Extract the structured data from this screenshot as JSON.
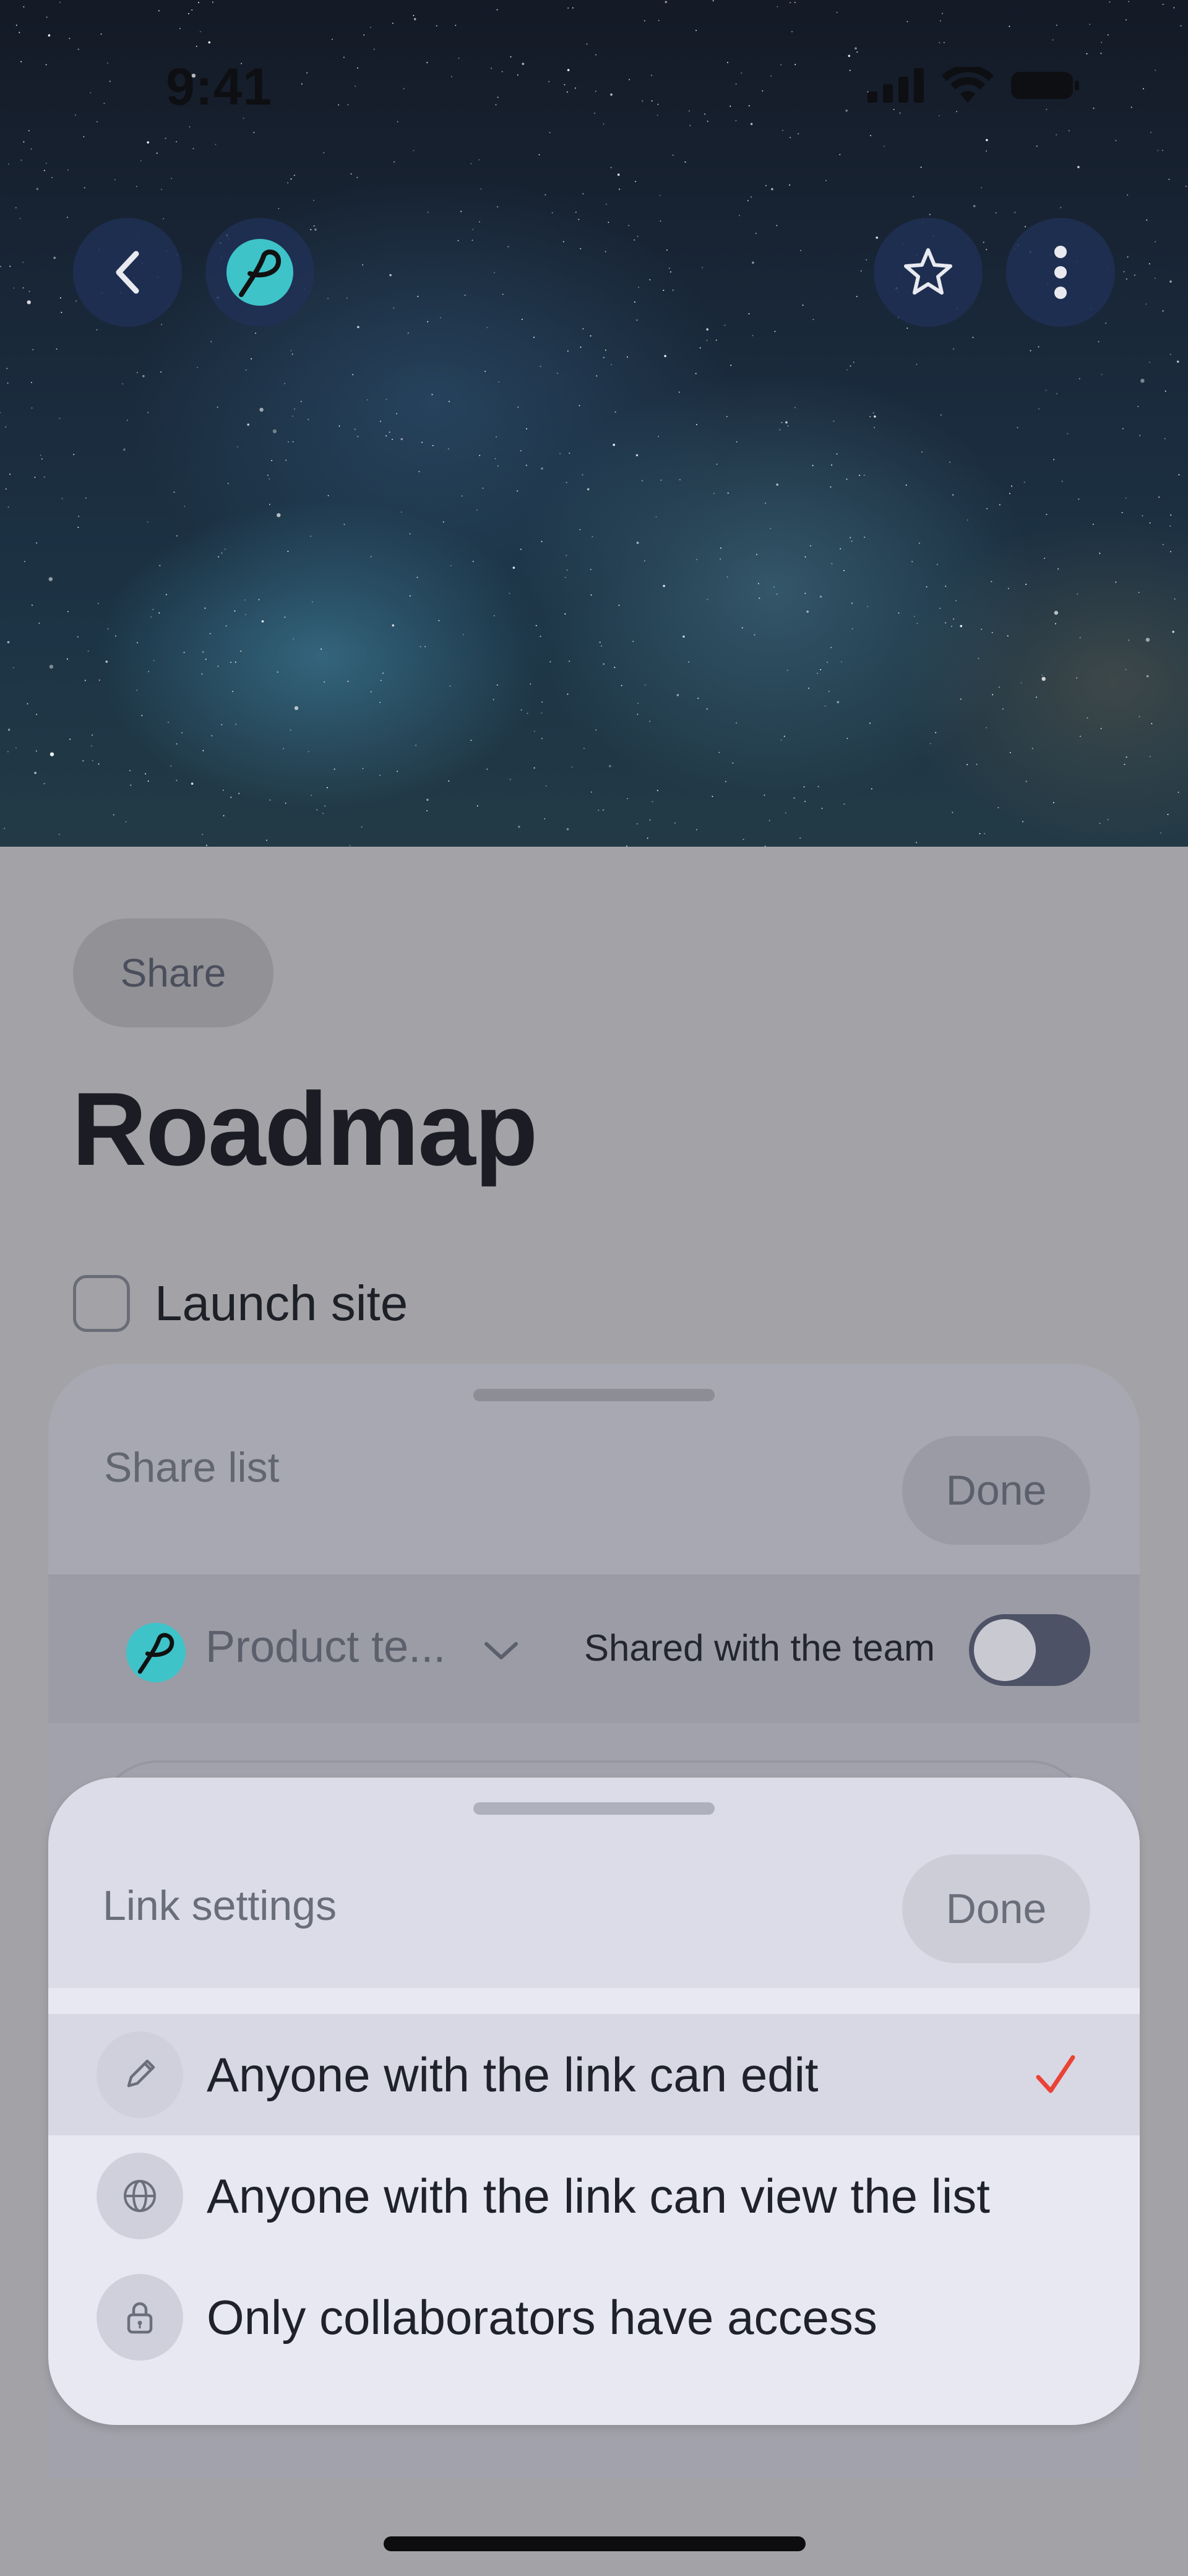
{
  "status_bar": {
    "time": "9:41"
  },
  "hero": {
    "back_icon": "chevron-left-icon",
    "workspace_icon": "workspace-logo-icon",
    "favorite_icon": "star-icon",
    "more_icon": "more-vertical-icon"
  },
  "page": {
    "share_chip": "Share",
    "title": "Roadmap",
    "task": {
      "label": "Launch site",
      "checked": false
    }
  },
  "share_sheet": {
    "title": "Share list",
    "done": "Done",
    "team": {
      "name": "Product te...",
      "toggle_label": "Shared with the team",
      "toggle_on": false
    }
  },
  "link_sheet": {
    "title": "Link settings",
    "done": "Done",
    "options": [
      {
        "label": "Anyone with the link can edit",
        "icon": "pencil-icon",
        "selected": true
      },
      {
        "label": "Anyone with the link can view the list",
        "icon": "globe-icon",
        "selected": false
      },
      {
        "label": "Only collaborators have access",
        "icon": "lock-icon",
        "selected": false
      }
    ]
  },
  "colors": {
    "accent": "#ea4335",
    "brand_teal": "#3ec3c9",
    "hero_button": "#203055"
  }
}
